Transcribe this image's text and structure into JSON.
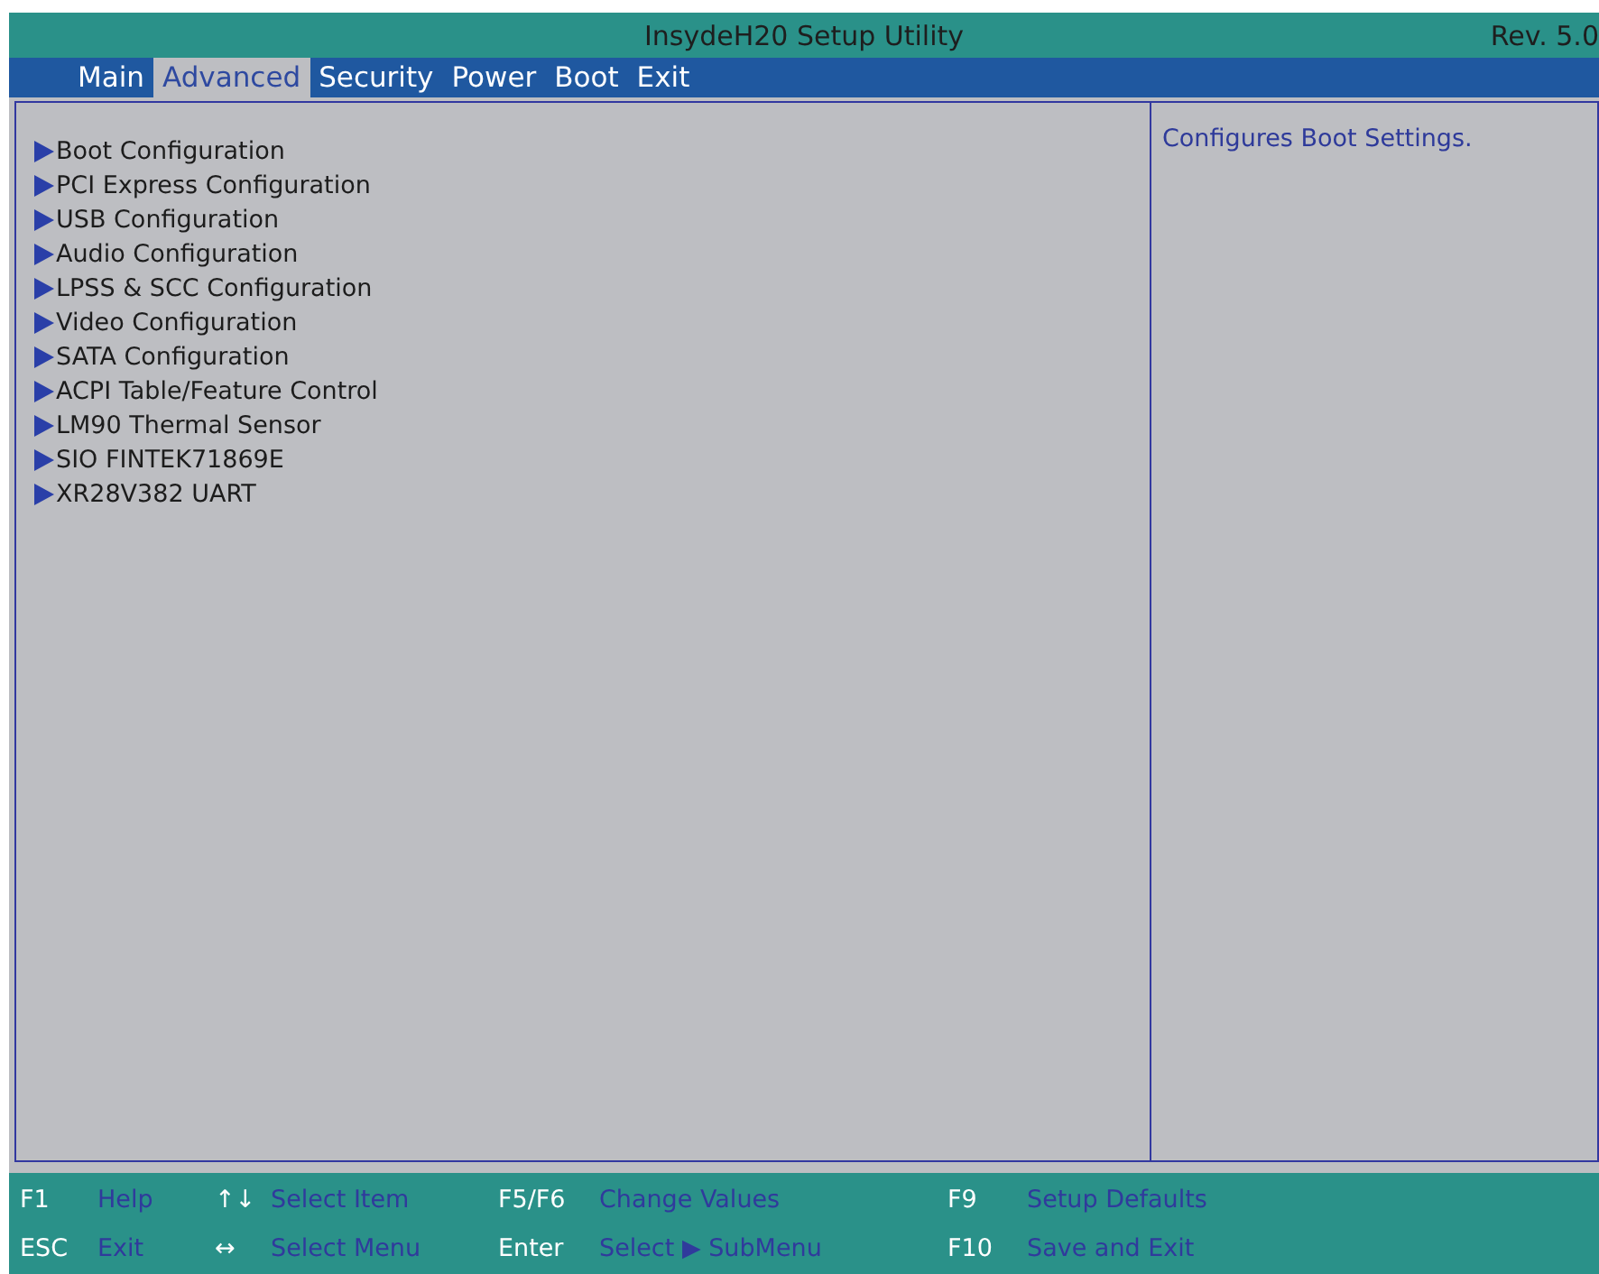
{
  "window": {
    "title": "InsydeH20 Setup Utility",
    "revision": "Rev. 5.0"
  },
  "tabs": [
    {
      "label": "Main",
      "selected": false
    },
    {
      "label": "Advanced",
      "selected": true
    },
    {
      "label": "Security",
      "selected": false
    },
    {
      "label": "Power",
      "selected": false
    },
    {
      "label": "Boot",
      "selected": false
    },
    {
      "label": "Exit",
      "selected": false
    }
  ],
  "menu_items": [
    {
      "label": "Boot Configuration"
    },
    {
      "label": "PCI Express Configuration"
    },
    {
      "label": "USB Configuration"
    },
    {
      "label": "Audio Configuration"
    },
    {
      "label": "LPSS & SCC Configuration"
    },
    {
      "label": "Video Configuration"
    },
    {
      "label": "SATA Configuration"
    },
    {
      "label": "ACPI Table/Feature Control"
    },
    {
      "label": "LM90 Thermal Sensor"
    },
    {
      "label": "SIO FINTEK71869E"
    },
    {
      "label": "XR28V382 UART"
    }
  ],
  "help_panel": {
    "text": "Configures Boot Settings."
  },
  "status_bar": [
    {
      "key": "F1",
      "action": "Help"
    },
    {
      "key": "ESC",
      "action": "Exit"
    },
    {
      "key": "↑↓",
      "action": "Select Item"
    },
    {
      "key": "↔",
      "action": "Select Menu"
    },
    {
      "key": "F5/F6",
      "action": "Change Values"
    },
    {
      "key": "Enter",
      "action": "Select ▶ SubMenu"
    },
    {
      "key": "F9",
      "action": "Setup Defaults"
    },
    {
      "key": "F10",
      "action": "Save and Exit"
    }
  ]
}
